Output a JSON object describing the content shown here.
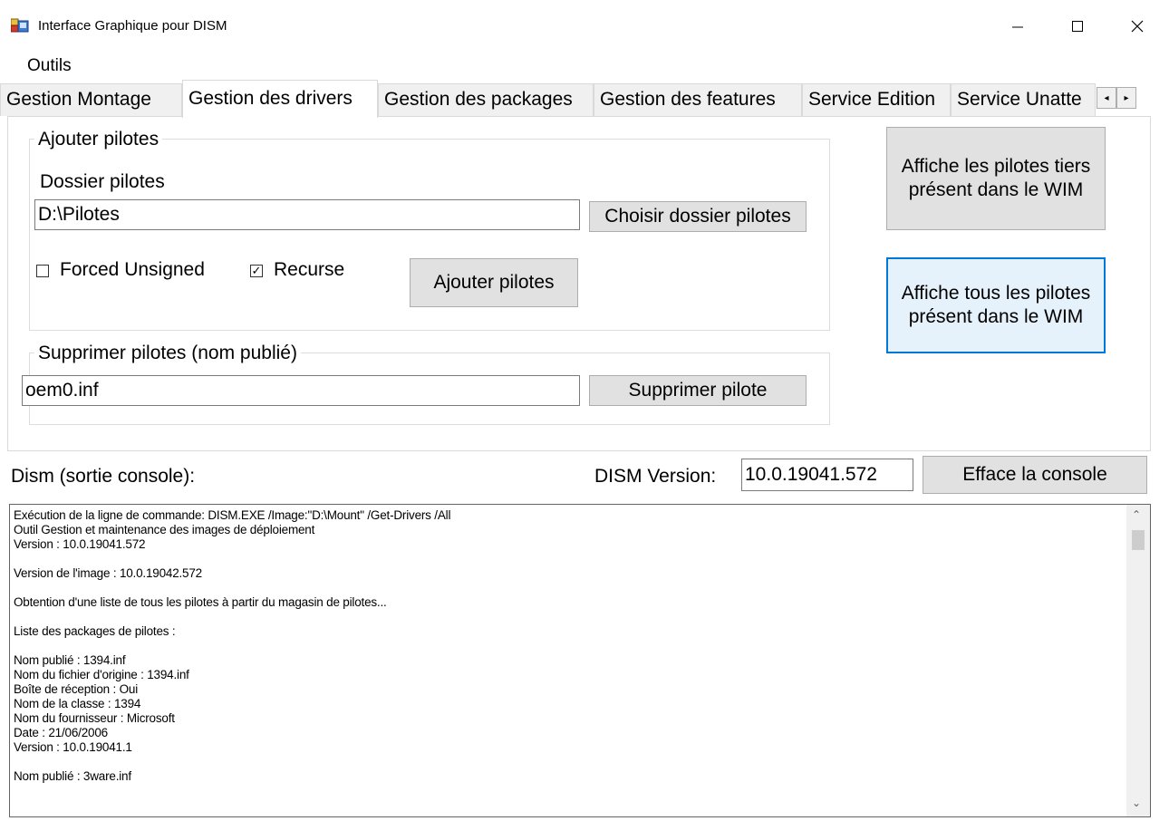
{
  "window": {
    "title": "Interface Graphique pour DISM"
  },
  "menu": {
    "outils": "Outils"
  },
  "tabs": [
    {
      "label": "Gestion Montage"
    },
    {
      "label": "Gestion des drivers"
    },
    {
      "label": "Gestion des packages"
    },
    {
      "label": "Gestion des features"
    },
    {
      "label": "Service Edition"
    },
    {
      "label": "Service Unatte"
    }
  ],
  "active_tab": "Gestion des drivers",
  "add_group": {
    "title": "Ajouter pilotes",
    "folder_label": "Dossier pilotes",
    "folder_value": "D:\\Pilotes",
    "choose_button": "Choisir dossier pilotes",
    "forced_unsigned": {
      "label": "Forced Unsigned",
      "checked": false
    },
    "recurse": {
      "label": "Recurse",
      "checked": true
    },
    "add_button": "Ajouter pilotes"
  },
  "remove_group": {
    "title": "Supprimer pilotes (nom publié)",
    "value": "oem0.inf",
    "remove_button": "Supprimer pilote"
  },
  "side_buttons": {
    "third_party": "Affiche les pilotes tiers présent dans le WIM",
    "all": "Affiche tous les pilotes présent dans le WIM"
  },
  "console_section": {
    "label": "Dism (sortie console):",
    "version_label": "DISM Version:",
    "version_value": "10.0.19041.572",
    "clear_button": "Efface la console"
  },
  "console_lines": [
    "Exécution de la ligne de commande: DISM.EXE /Image:\"D:\\Mount\" /Get-Drivers /All",
    "Outil Gestion et maintenance des images de déploiement",
    "Version : 10.0.19041.572",
    "",
    "Version de l'image : 10.0.19042.572",
    "",
    "Obtention d'une liste de tous les pilotes à partir du magasin de pilotes...",
    "",
    "Liste des packages de pilotes :",
    "",
    "Nom publié : 1394.inf",
    "Nom du fichier d'origine : 1394.inf",
    "Boîte de réception : Oui",
    "Nom de la classe : 1394",
    "Nom du fournisseur : Microsoft",
    "Date : 21/06/2006",
    "Version : 10.0.19041.1",
    "",
    "Nom publié : 3ware.inf"
  ]
}
